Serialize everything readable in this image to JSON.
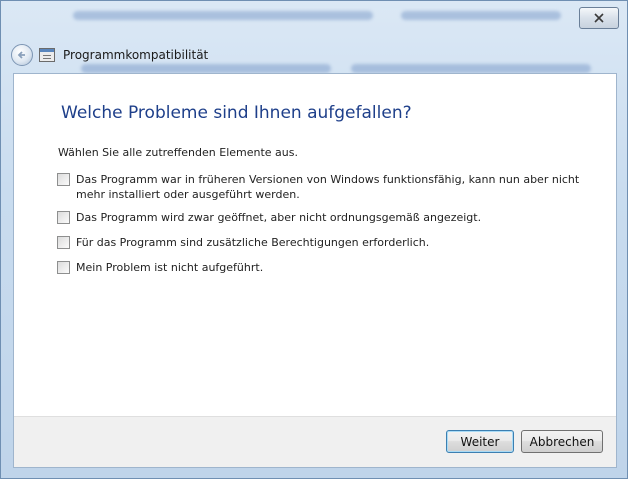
{
  "window": {
    "title": "Programmkompatibilität",
    "close_icon": "close-icon",
    "back_icon": "back-arrow-icon"
  },
  "main": {
    "heading": "Welche Probleme sind Ihnen aufgefallen?",
    "instruction": "Wählen Sie alle zutreffenden Elemente aus.",
    "options": [
      {
        "label": "Das Programm war in früheren Versionen von Windows funktionsfähig, kann nun aber nicht mehr installiert oder ausgeführt werden.",
        "checked": false
      },
      {
        "label": "Das Programm wird zwar geöffnet, aber nicht ordnungsgemäß angezeigt.",
        "checked": false
      },
      {
        "label": "Für das Programm sind zusätzliche Berechtigungen erforderlich.",
        "checked": false
      },
      {
        "label": "Mein Problem ist nicht aufgeführt.",
        "checked": false
      }
    ]
  },
  "footer": {
    "next_label": "Weiter",
    "cancel_label": "Abbrechen"
  },
  "colors": {
    "heading": "#1e3f8a",
    "frame": "#c9dcef",
    "accent": "#3c7fb1"
  }
}
